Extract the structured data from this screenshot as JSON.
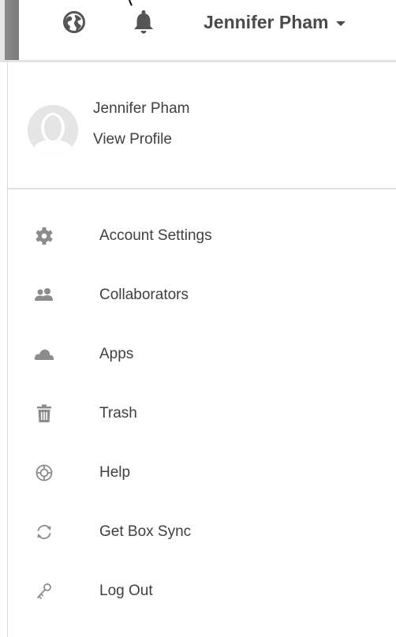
{
  "topbar": {
    "user_name": "Jennifer Pham",
    "icons": [
      "globe-icon",
      "bell-icon",
      "chevron-down-icon"
    ]
  },
  "dropdown": {
    "profile": {
      "name": "Jennifer Pham",
      "link_label": "View Profile"
    },
    "items": [
      {
        "label": "Account Settings",
        "icon": "gear-icon"
      },
      {
        "label": "Collaborators",
        "icon": "people-icon"
      },
      {
        "label": "Apps",
        "icon": "cloud-icon"
      },
      {
        "label": "Trash",
        "icon": "trash-icon"
      },
      {
        "label": "Help",
        "icon": "lifebuoy-icon"
      },
      {
        "label": "Get Box Sync",
        "icon": "sync-icon"
      },
      {
        "label": "Log Out",
        "icon": "key-icon"
      }
    ]
  },
  "colors": {
    "text": "#404040",
    "icon": "#8c8c8c",
    "divider": "#dedede"
  }
}
